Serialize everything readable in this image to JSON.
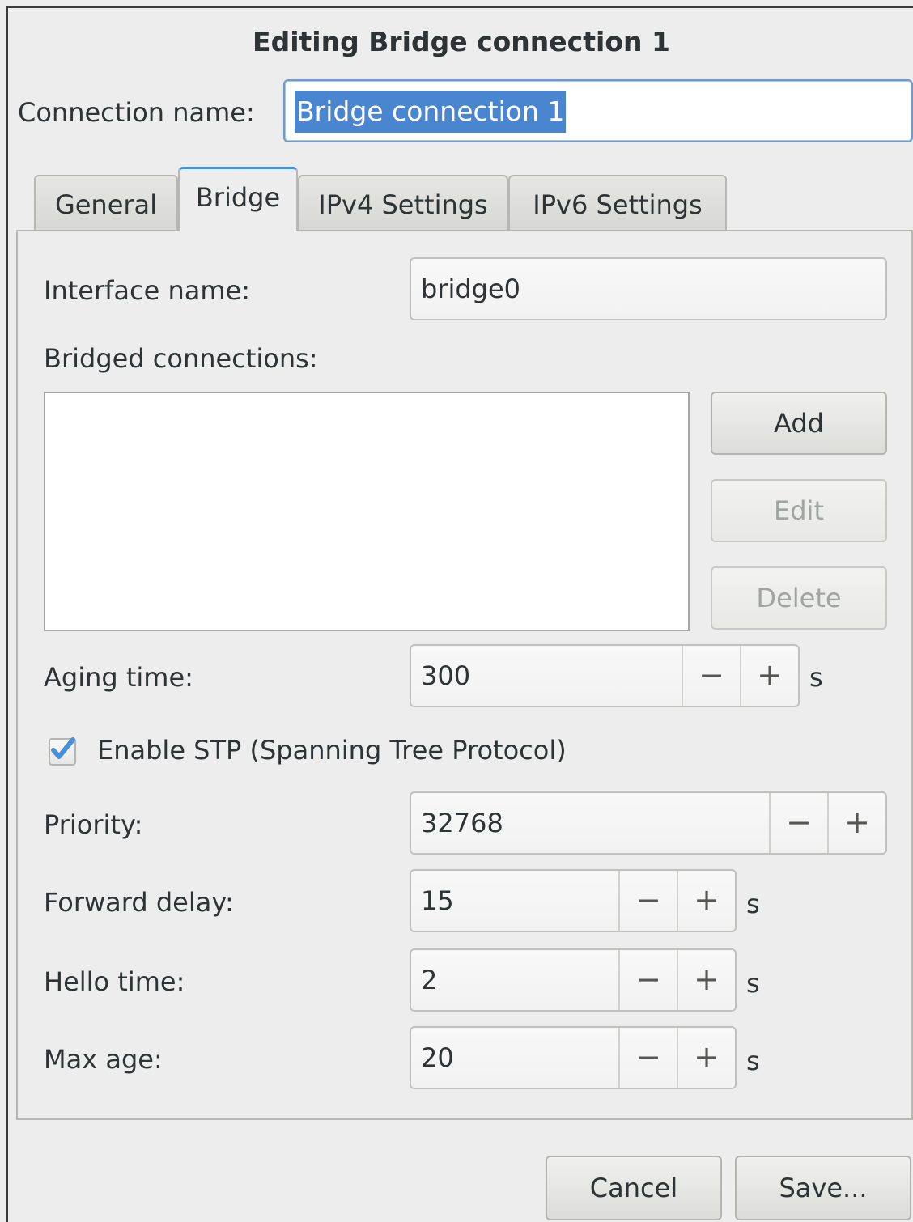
{
  "window": {
    "title": "Editing Bridge connection 1"
  },
  "connection": {
    "label": "Connection name:",
    "value": "Bridge connection 1"
  },
  "tabs": [
    {
      "label": "General",
      "active": false
    },
    {
      "label": "Bridge",
      "active": true
    },
    {
      "label": "IPv4 Settings",
      "active": false
    },
    {
      "label": "IPv6 Settings",
      "active": false
    }
  ],
  "bridge": {
    "interface_label": "Interface name:",
    "interface_value": "bridge0",
    "bridged_label": "Bridged connections:",
    "add_label": "Add",
    "edit_label": "Edit",
    "delete_label": "Delete",
    "aging_label": "Aging time:",
    "aging_value": "300",
    "aging_unit": "s",
    "stp_label": "Enable STP (Spanning Tree Protocol)",
    "stp_checked": true,
    "priority_label": "Priority:",
    "priority_value": "32768",
    "forward_label": "Forward delay:",
    "forward_value": "15",
    "forward_unit": "s",
    "hello_label": "Hello time:",
    "hello_value": "2",
    "hello_unit": "s",
    "maxage_label": "Max age:",
    "maxage_value": "20",
    "maxage_unit": "s",
    "minus": "−",
    "plus": "+"
  },
  "footer": {
    "cancel_label": "Cancel",
    "save_label": "Save..."
  },
  "colors": {
    "accent": "#4a86cf",
    "check": "#4a90d9"
  }
}
